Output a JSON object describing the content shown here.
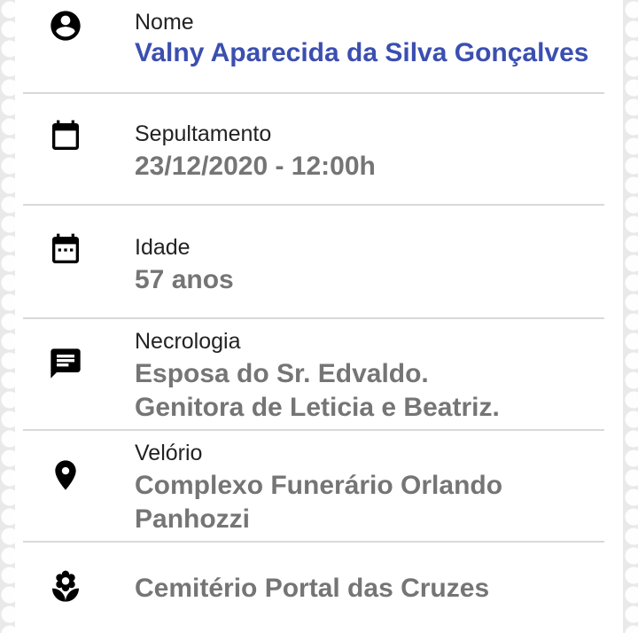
{
  "records": {
    "nome": {
      "label": "Nome",
      "value": "Valny Aparecida da Silva Gonçalves",
      "icon": "person-circle-icon"
    },
    "sepultamento": {
      "label": "Sepultamento",
      "value": "23/12/2020 - 12:00h",
      "icon": "calendar-icon"
    },
    "idade": {
      "label": "Idade",
      "value": "57 anos",
      "icon": "calendar-dots-icon"
    },
    "necrologia": {
      "label": "Necrologia",
      "lines": [
        "Esposa do Sr. Edvaldo.",
        "Genitora de Leticia e Beatriz."
      ],
      "icon": "message-icon"
    },
    "velorio": {
      "label": "Velório",
      "lines": [
        "Complexo Funerário Orlando",
        "Panhozzi"
      ],
      "icon": "location-pin-icon"
    },
    "cemiterio": {
      "value": "Cemitério Portal das Cruzes",
      "icon": "flower-icon"
    }
  },
  "colors": {
    "name_value": "#3b4fb0",
    "value_text": "#757575",
    "label_text": "#222222",
    "divider": "#d9d9d9"
  }
}
